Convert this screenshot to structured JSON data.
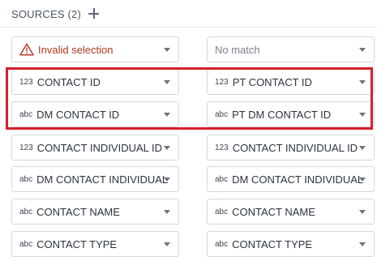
{
  "header": {
    "title": "SOURCES (2)"
  },
  "colors": {
    "accent_highlight": "#d4202a",
    "error_text": "#b2371a"
  },
  "rows": [
    {
      "left": {
        "icon": "warning-icon",
        "type": "",
        "label": "Invalid selection",
        "state": "error"
      },
      "right": {
        "icon": "",
        "type": "",
        "label": "No match",
        "state": "muted"
      }
    },
    {
      "left": {
        "type": "123",
        "label": "CONTACT ID"
      },
      "right": {
        "type": "123",
        "label": "PT CONTACT ID"
      }
    },
    {
      "left": {
        "type": "abc",
        "label": "DM CONTACT ID"
      },
      "right": {
        "type": "abc",
        "label": "PT DM CONTACT ID"
      }
    },
    {
      "left": {
        "type": "123",
        "label": "CONTACT INDIVIDUAL ID"
      },
      "right": {
        "type": "123",
        "label": "CONTACT INDIVIDUAL ID"
      }
    },
    {
      "left": {
        "type": "abc",
        "label": "DM CONTACT INDIVIDUAL"
      },
      "right": {
        "type": "abc",
        "label": "DM CONTACT INDIVIDUAL"
      }
    },
    {
      "left": {
        "type": "abc",
        "label": "CONTACT NAME"
      },
      "right": {
        "type": "abc",
        "label": "CONTACT NAME"
      }
    },
    {
      "left": {
        "type": "abc",
        "label": "CONTACT TYPE"
      },
      "right": {
        "type": "abc",
        "label": "CONTACT TYPE"
      }
    }
  ]
}
